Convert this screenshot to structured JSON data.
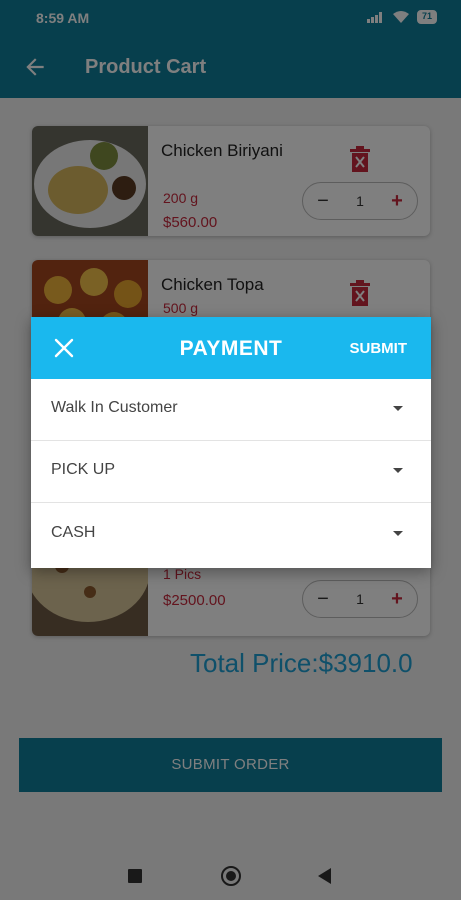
{
  "status_bar": {
    "time": "8:59 AM",
    "battery": "71"
  },
  "app_bar": {
    "title": "Product Cart"
  },
  "cart": {
    "items": [
      {
        "name": "Chicken Biriyani",
        "quantity_label": "200 g",
        "price": "$560.00",
        "count": "1"
      },
      {
        "name": "Chicken Topa",
        "quantity_label": "500 g",
        "price": "",
        "count": ""
      },
      {
        "name": "",
        "quantity_label": "1 Pics",
        "price": "$2500.00",
        "count": "1"
      }
    ],
    "total": "Total Price:$3910.0",
    "submit_label": "SUBMIT ORDER"
  },
  "dialog": {
    "title": "PAYMENT",
    "submit_label": "SUBMIT",
    "fields": [
      {
        "value": "Walk In Customer"
      },
      {
        "value": "PICK UP"
      },
      {
        "value": "CASH"
      }
    ]
  },
  "colors": {
    "primary": "#0e7e9b",
    "dialog_header": "#1ab8ee",
    "accent_red": "#c6283c",
    "total_text": "#1ea0d4"
  },
  "icons": [
    "back-arrow",
    "trash",
    "minus",
    "plus",
    "close",
    "dropdown-caret",
    "nav-recent",
    "nav-home",
    "nav-back"
  ]
}
